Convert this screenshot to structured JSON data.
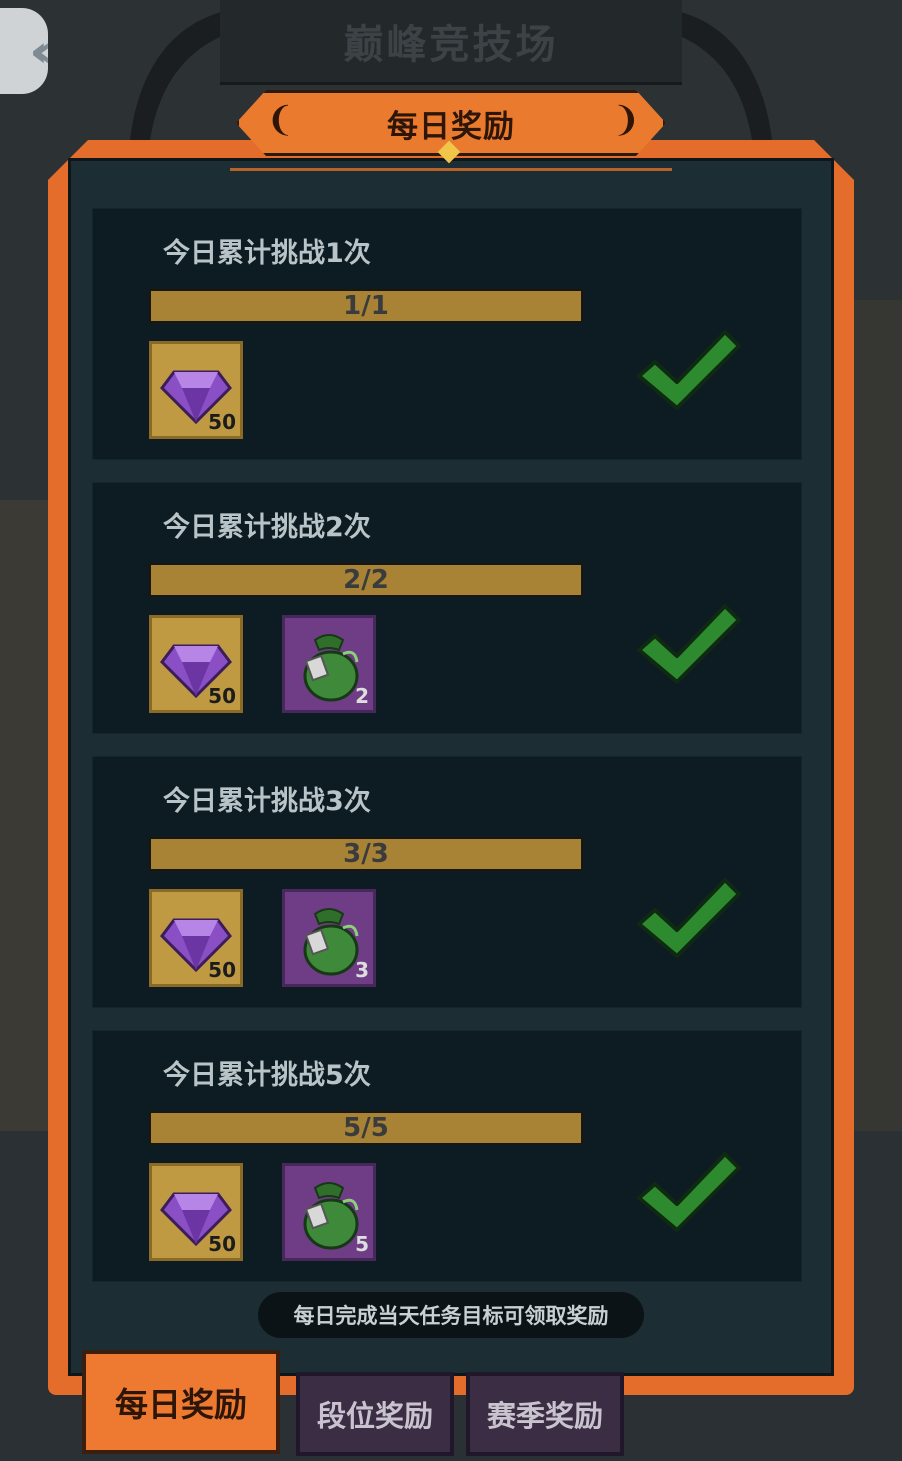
{
  "header": {
    "title": "巅峰竞技场",
    "ribbon_title": "每日奖励"
  },
  "tasks": [
    {
      "title": "今日累计挑战1次",
      "progress_text": "1/1",
      "progress": 1.0,
      "rewards": [
        {
          "icon": "purple-gem-icon",
          "qty": "50"
        }
      ],
      "completed": true
    },
    {
      "title": "今日累计挑战2次",
      "progress_text": "2/2",
      "progress": 1.0,
      "rewards": [
        {
          "icon": "purple-gem-icon",
          "qty": "50"
        },
        {
          "icon": "green-bag-icon",
          "qty": "2"
        }
      ],
      "completed": true
    },
    {
      "title": "今日累计挑战3次",
      "progress_text": "3/3",
      "progress": 1.0,
      "rewards": [
        {
          "icon": "purple-gem-icon",
          "qty": "50"
        },
        {
          "icon": "green-bag-icon",
          "qty": "3"
        }
      ],
      "completed": true
    },
    {
      "title": "今日累计挑战5次",
      "progress_text": "5/5",
      "progress": 1.0,
      "rewards": [
        {
          "icon": "purple-gem-icon",
          "qty": "50"
        },
        {
          "icon": "green-bag-icon",
          "qty": "5"
        }
      ],
      "completed": true
    }
  ],
  "hint": "每日完成当天任务目标可领取奖励",
  "tabs": [
    {
      "label": "每日奖励",
      "active": true
    },
    {
      "label": "段位奖励",
      "active": false
    },
    {
      "label": "赛季奖励",
      "active": false
    }
  ],
  "colors": {
    "frame_orange": "#e56d2b",
    "panel_dark": "#1c2d33",
    "progress_gold": "#a88235",
    "check_green": "#2e8a2e",
    "gem_purple": "#8a4fc4",
    "bag_green": "#3f8a3a"
  }
}
